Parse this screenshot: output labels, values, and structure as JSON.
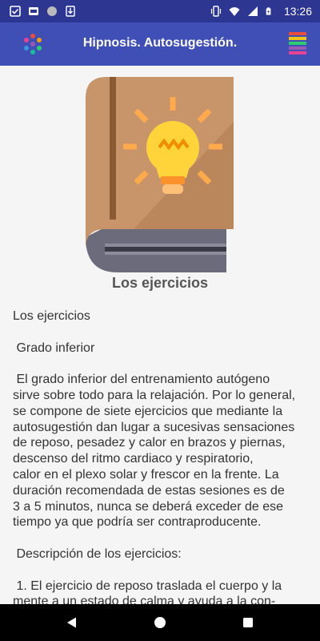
{
  "status_bar": {
    "time": "13:26",
    "left_icons": [
      "checkbox-icon",
      "cloud-icon",
      "circle-icon",
      "download-icon"
    ],
    "right_icons": [
      "vibrate-icon",
      "wifi-icon",
      "signal-icon",
      "battery-charging-icon"
    ]
  },
  "app_bar": {
    "title": "Hipnosis. Autosugestión.",
    "logo_icon": "colored-dots-logo-icon",
    "menu_icon": "striped-menu-icon"
  },
  "content": {
    "image_icon": "book-lightbulb-icon",
    "heading": "Los ejercicios",
    "lines": [
      "Los ejercicios",
      "",
      " Grado inferior",
      "",
      " El grado inferior del entrenamiento autógeno",
      "sirve sobre todo para la relajación. Por lo general,",
      "se compone de siete ejercicios que mediante la",
      "autosugestión dan lugar a sucesivas sensaciones",
      "de reposo, pesadez y calor en brazos y piernas,",
      "descenso del ritmo cardiaco y respiratorio,",
      "calor en el plexo solar y frescor en la frente. La",
      "duración recomendada de estas sesiones es de",
      "3 a 5 minutos, nunca se deberá exceder de ese",
      "tiempo ya que podría ser contraproducente.",
      "",
      " Descripción de los ejercicios:",
      "",
      " 1. El ejercicio de reposo traslada el cuerpo y la",
      "mente a un estado de calma y ayuda a la con-"
    ]
  },
  "nav_bar": {
    "icons": [
      "back-triangle-icon",
      "home-circle-icon",
      "recents-square-icon"
    ]
  },
  "colors": {
    "status_bar": "#2d3792",
    "app_bar": "#3f4fb5",
    "background": "#f5f5f5",
    "book_cover": "#c8956a",
    "bulb": "#ffd43b",
    "rays": "#ffa94d"
  }
}
